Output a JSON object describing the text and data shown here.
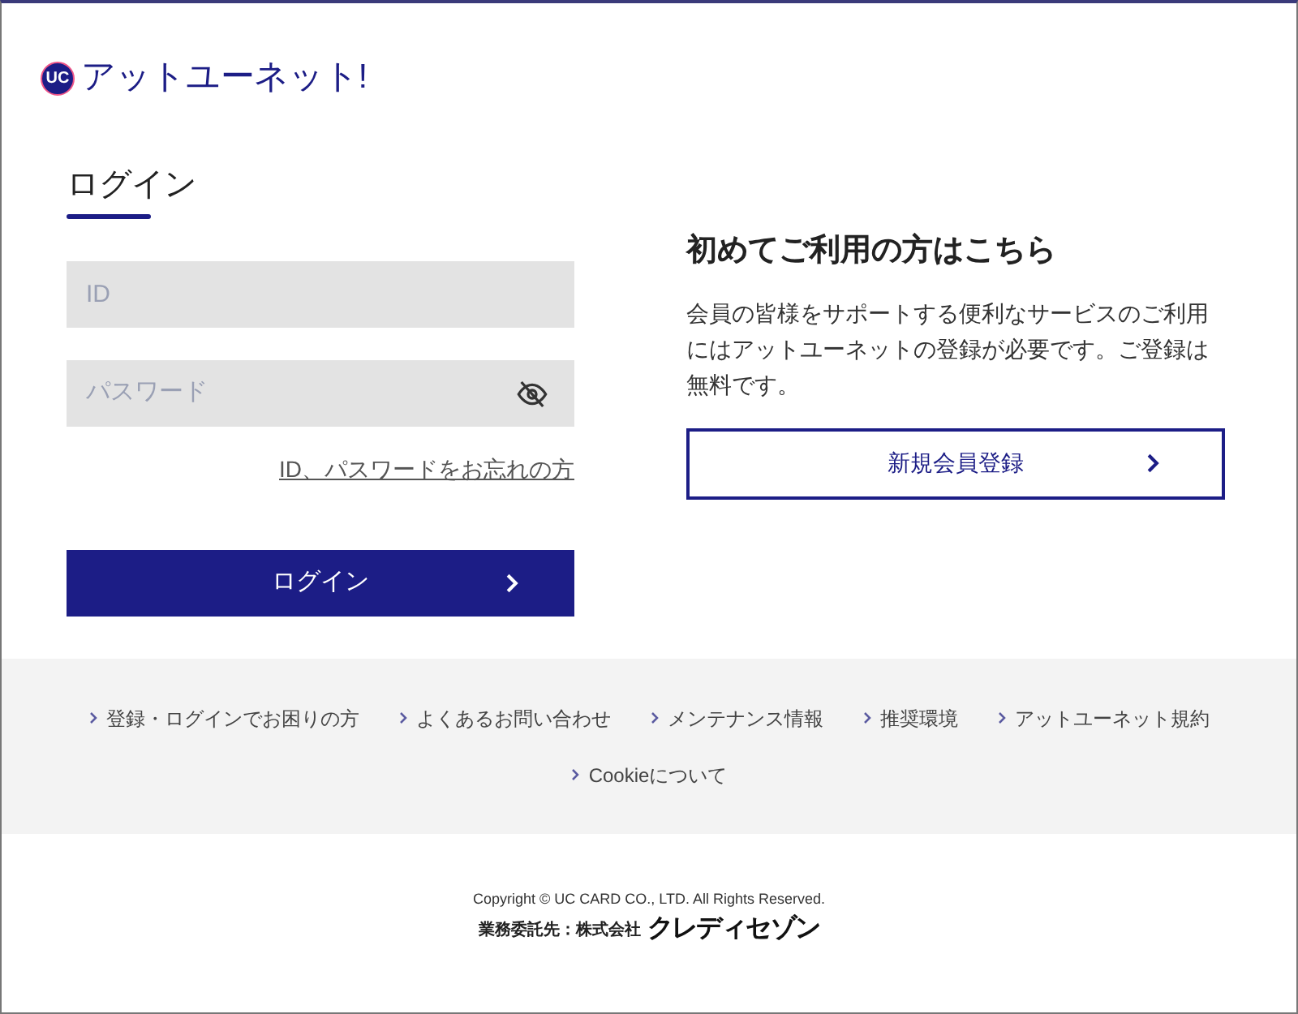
{
  "header": {
    "logo_mark": "UC",
    "site_name": "アットユーネット!"
  },
  "login": {
    "title": "ログイン",
    "id_field": {
      "placeholder": "ID"
    },
    "password_field": {
      "placeholder": "パスワード"
    },
    "forgot_link": "ID、パスワードをお忘れの方",
    "submit": "ログイン"
  },
  "signup": {
    "title": "初めてご利用の方はこちら",
    "description": "会員の皆様をサポートする便利なサービスのご利用にはアットユーネットの登録が必要です。ご登録は無料です。",
    "button": "新規会員登録"
  },
  "footer_links": [
    "登録・ログインでお困りの方",
    "よくあるお問い合わせ",
    "メンテナンス情報",
    "推奨環境",
    "アットユーネット規約",
    "Cookieについて"
  ],
  "copyright": "Copyright © UC CARD CO., LTD. All Rights Reserved.",
  "contractor": {
    "label": "業務委託先：株式会社",
    "company": "クレディセゾン"
  }
}
